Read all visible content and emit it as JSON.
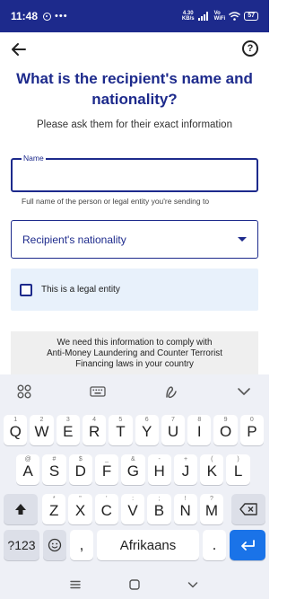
{
  "status_bar": {
    "time": "11:48",
    "more": "•••",
    "speed_value": "4.30",
    "speed_unit": "KB/s",
    "network_line1": "Vo",
    "network_line2": "WiFi",
    "battery": "57"
  },
  "header": {
    "back_icon": "arrow-left-icon",
    "help_icon": "question-circle-icon",
    "help_symbol": "?"
  },
  "page": {
    "title": "What is the recipient's name and nationality?",
    "subtitle": "Please ask them for their exact information"
  },
  "form": {
    "name_label": "Name",
    "name_value": "",
    "name_helper": "Full name of the person or legal entity you're sending to",
    "nationality_label": "Recipient's nationality",
    "legal_entity_label": "This is a legal entity",
    "legal_entity_checked": false
  },
  "info": {
    "line1": "We need this information to comply with",
    "line2": "Anti-Money Laundering and Counter Terrorist",
    "line3": "Financing laws in your country"
  },
  "keyboard": {
    "toolbar_icons": [
      "grid-icon",
      "keyboard-icon",
      "handwriting-icon",
      "chevron-down-icon"
    ],
    "row1": [
      {
        "key": "Q",
        "hint": "1"
      },
      {
        "key": "W",
        "hint": "2"
      },
      {
        "key": "E",
        "hint": "3"
      },
      {
        "key": "R",
        "hint": "4"
      },
      {
        "key": "T",
        "hint": "5"
      },
      {
        "key": "Y",
        "hint": "6"
      },
      {
        "key": "U",
        "hint": "7"
      },
      {
        "key": "I",
        "hint": "8"
      },
      {
        "key": "O",
        "hint": "9"
      },
      {
        "key": "P",
        "hint": "0"
      }
    ],
    "row2": [
      {
        "key": "A",
        "hint": "@"
      },
      {
        "key": "S",
        "hint": "#"
      },
      {
        "key": "D",
        "hint": "$"
      },
      {
        "key": "F",
        "hint": "_"
      },
      {
        "key": "G",
        "hint": "&"
      },
      {
        "key": "H",
        "hint": "-"
      },
      {
        "key": "J",
        "hint": "+"
      },
      {
        "key": "K",
        "hint": "("
      },
      {
        "key": "L",
        "hint": ")"
      }
    ],
    "row3": [
      {
        "key": "Z",
        "hint": "*"
      },
      {
        "key": "X",
        "hint": "\""
      },
      {
        "key": "C",
        "hint": "'"
      },
      {
        "key": "V",
        "hint": ":"
      },
      {
        "key": "B",
        "hint": ";"
      },
      {
        "key": "N",
        "hint": "!"
      },
      {
        "key": "M",
        "hint": "?"
      }
    ],
    "symbols_key": "?123",
    "comma_key": ",",
    "space_label": "Afrikaans",
    "period_key": ".",
    "shift_icon": "shift-icon",
    "backspace_icon": "backspace-icon",
    "emoji_icon": "emoji-icon",
    "enter_icon": "enter-icon",
    "accent_color": "#1a73e8"
  },
  "nav_bar": {
    "icons": [
      "menu-icon",
      "home-square-icon",
      "back-chevron-icon"
    ]
  },
  "colors": {
    "brand": "#1d2a8c",
    "legal_bg": "#e8f1fb",
    "info_bg": "#efefef"
  }
}
